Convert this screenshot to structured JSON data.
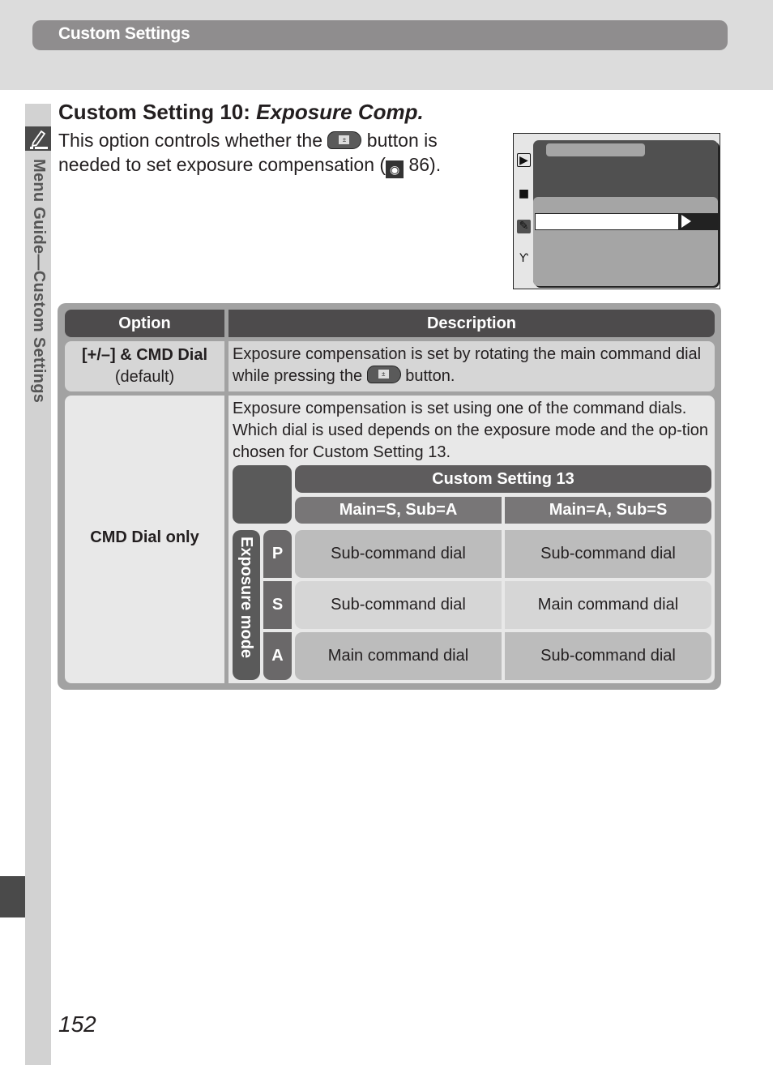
{
  "header": {
    "section_title": "Custom Settings"
  },
  "sidebar": {
    "label": "Menu Guide—Custom Settings",
    "icon": "pencil-icon"
  },
  "page": {
    "title_prefix": "Custom Setting 10: ",
    "title_italic": "Exposure Comp.",
    "intro_part1": "This option controls whether the ",
    "intro_part2": " button is needed to set exposure compensation (",
    "intro_ref": "86",
    "intro_part3": ").",
    "page_number": "152"
  },
  "camera_screen": {
    "menu_icons": [
      "playback-icon",
      "camera-icon",
      "pencil-icon",
      "wrench-icon"
    ],
    "selected_menu": "pencil-icon"
  },
  "table": {
    "headers": {
      "option": "Option",
      "description": "Description"
    },
    "rows": [
      {
        "option": "[+/–] & CMD Dial",
        "option_note": "(default)",
        "description_part1": "Exposure compensation is set by rotating the main command dial while pressing the ",
        "description_part2": " button."
      },
      {
        "option": "CMD Dial only",
        "description": "Exposure compensation is set using one of the command dials. Which dial is used depends on the exposure mode and the op-tion chosen for Custom Setting 13."
      }
    ],
    "subtable": {
      "title": "Custom Setting 13",
      "columns": [
        "Main=S, Sub=A",
        "Main=A, Sub=S"
      ],
      "row_group_label": "Exposure mode",
      "rows": [
        {
          "mode": "P",
          "values": [
            "Sub-command dial",
            "Sub-command dial"
          ]
        },
        {
          "mode": "S",
          "values": [
            "Sub-command dial",
            "Main command dial"
          ]
        },
        {
          "mode": "A",
          "values": [
            "Main command dial",
            "Sub-command dial"
          ]
        }
      ]
    }
  }
}
